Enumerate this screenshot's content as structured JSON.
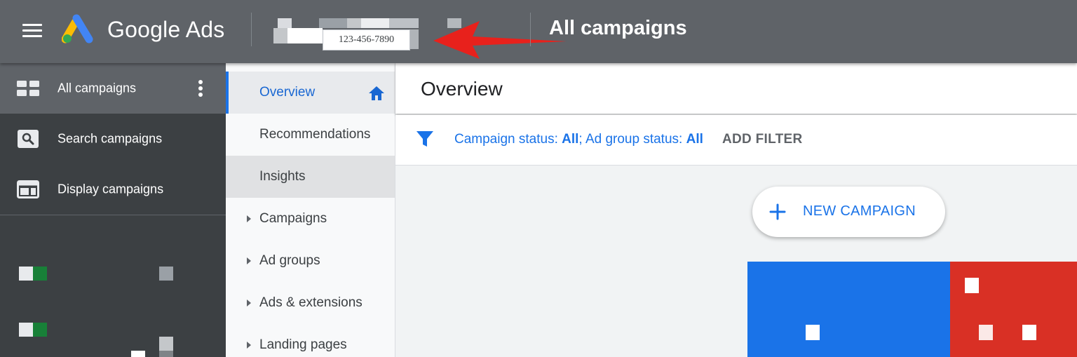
{
  "header": {
    "product_name": "Google Ads",
    "account_phone": "123-456-7890",
    "title": "All campaigns"
  },
  "sidebar": {
    "items": [
      {
        "label": "All campaigns",
        "icon": "grid-icon",
        "active": true
      },
      {
        "label": "Search campaigns",
        "icon": "search-icon"
      },
      {
        "label": "Display campaigns",
        "icon": "display-icon"
      }
    ]
  },
  "pagenav": {
    "items": [
      {
        "label": "Overview",
        "active": true
      },
      {
        "label": "Recommendations"
      },
      {
        "label": "Insights"
      },
      {
        "label": "Campaigns",
        "expandable": true
      },
      {
        "label": "Ad groups",
        "expandable": true
      },
      {
        "label": "Ads & extensions",
        "expandable": true
      },
      {
        "label": "Landing pages",
        "expandable": true
      }
    ]
  },
  "main": {
    "title": "Overview",
    "filter": {
      "campaign_status_label": "Campaign status: ",
      "campaign_status_value": "All",
      "separator": "; ",
      "ad_group_status_label": "Ad group status: ",
      "ad_group_status_value": "All",
      "add_filter_label": "ADD FILTER"
    },
    "new_campaign_label": "NEW CAMPAIGN"
  },
  "colors": {
    "header_bg": "#5f6368",
    "sidebar_bg": "#3c4043",
    "accent_blue": "#1a73e8",
    "red": "#d93025",
    "annotation_arrow": "#e8211c"
  }
}
